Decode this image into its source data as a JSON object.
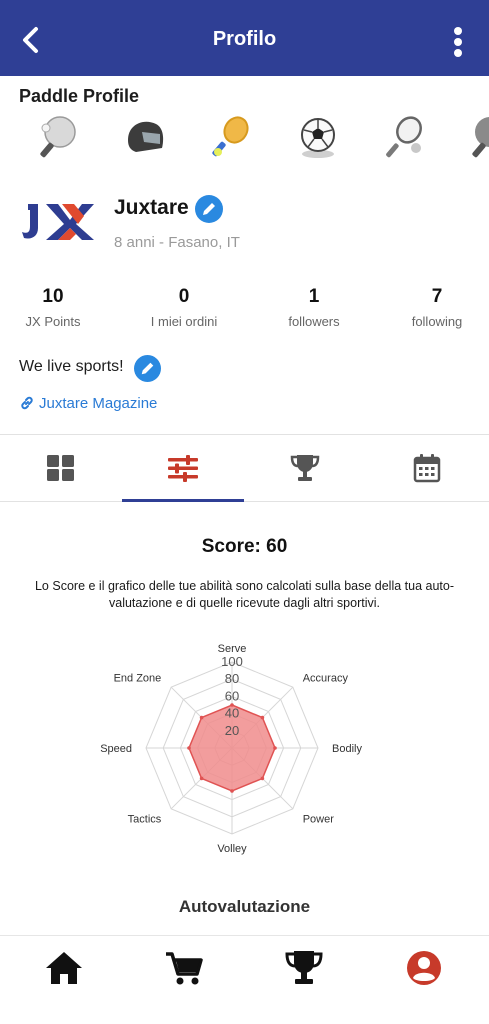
{
  "header": {
    "title": "Profilo"
  },
  "paddle": {
    "title": "Paddle Profile",
    "sports": [
      "ping-pong-icon",
      "motorbike-helmet-icon",
      "padel-icon",
      "soccer-ball-icon",
      "tennis-icon",
      "ping-pong-icon"
    ]
  },
  "profile": {
    "logo_text": "JX",
    "name": "Juxtare",
    "subtitle": "8 anni - Fasano, IT",
    "bio": "We live sports!",
    "link": "Juxtare Magazine"
  },
  "stats": [
    {
      "value": "10",
      "label": "JX Points"
    },
    {
      "value": "0",
      "label": "I miei ordini"
    },
    {
      "value": "1",
      "label": "followers"
    },
    {
      "value": "7",
      "label": "following"
    }
  ],
  "tabs": [
    {
      "icon": "grid-icon",
      "active": false
    },
    {
      "icon": "sliders-icon",
      "active": true
    },
    {
      "icon": "trophy-icon",
      "active": false
    },
    {
      "icon": "calendar-icon",
      "active": false
    }
  ],
  "score": {
    "title": "Score: 60",
    "description": "Lo Score e il grafico delle tue abilità sono calcolati sulla base della tua auto-valutazione e di quelle ricevute dagli altri sportivi."
  },
  "chart_data": {
    "type": "radar",
    "categories": [
      "Serve",
      "Accuracy",
      "Bodily",
      "Power",
      "Volley",
      "Tactics",
      "Speed",
      "End Zone"
    ],
    "ticks": [
      "20",
      "40",
      "60",
      "80",
      "100"
    ],
    "values": [
      50,
      50,
      50,
      50,
      50,
      50,
      50,
      50
    ],
    "rmax": 100,
    "colors": {
      "fill": "#f08c8c",
      "stroke": "#e05353",
      "grid": "#d6d6d6"
    }
  },
  "section": {
    "title": "Autovalutazione"
  },
  "colors": {
    "primary": "#2f3f95",
    "accent": "#e04a2f",
    "link": "#2a7bd5",
    "active_nav": "#c73a2a"
  },
  "bottom_nav": [
    "home-icon",
    "cart-icon",
    "trophy-icon",
    "profile-icon"
  ]
}
